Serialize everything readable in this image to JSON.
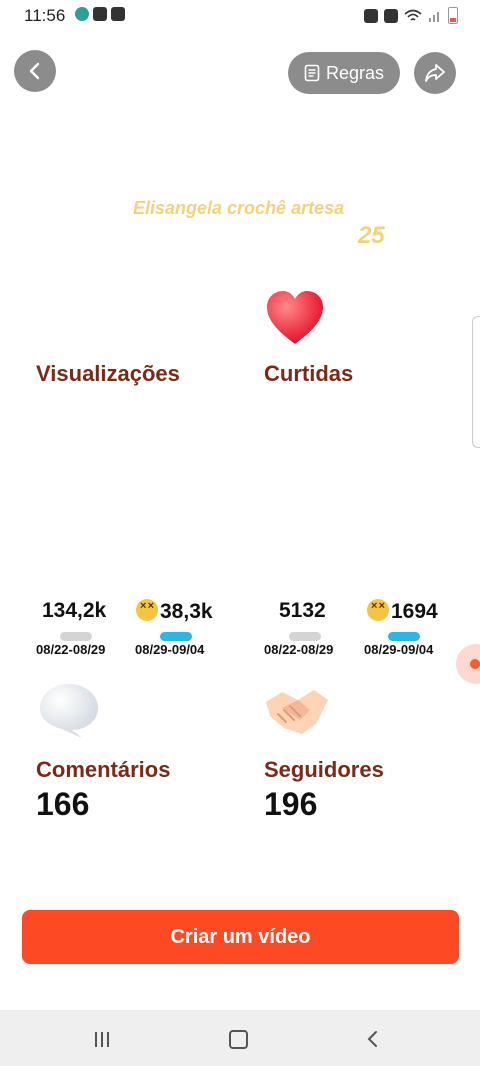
{
  "status_bar": {
    "time": "11:56"
  },
  "header": {
    "rules_label": "Regras"
  },
  "user": {
    "name": "Elisangela crochê artesa",
    "number": "25"
  },
  "metrics": {
    "views": {
      "label": "Visualizações",
      "prev_value": "134,2k",
      "prev_period": "08/22-08/29",
      "curr_value": "38,3k",
      "curr_period": "08/29-09/04"
    },
    "likes": {
      "label": "Curtidas",
      "prev_value": "5132",
      "prev_period": "08/22-08/29",
      "curr_value": "1694",
      "curr_period": "08/29-09/04"
    },
    "comments": {
      "label": "Comentários",
      "value": "166"
    },
    "followers": {
      "label": "Seguidores",
      "value": "196"
    }
  },
  "cta": {
    "label": "Criar um vídeo"
  },
  "colors": {
    "accent": "#fe4a24",
    "label": "#7a2a16",
    "name": "#f5d27a",
    "bar_prev": "#d4d4d4",
    "bar_curr": "#2bb7e3"
  },
  "icons": [
    "back-icon",
    "rules-icon",
    "share-icon",
    "heart-icon",
    "dizzy-emoji-icon",
    "speech-bubble-icon",
    "handshake-icon"
  ]
}
